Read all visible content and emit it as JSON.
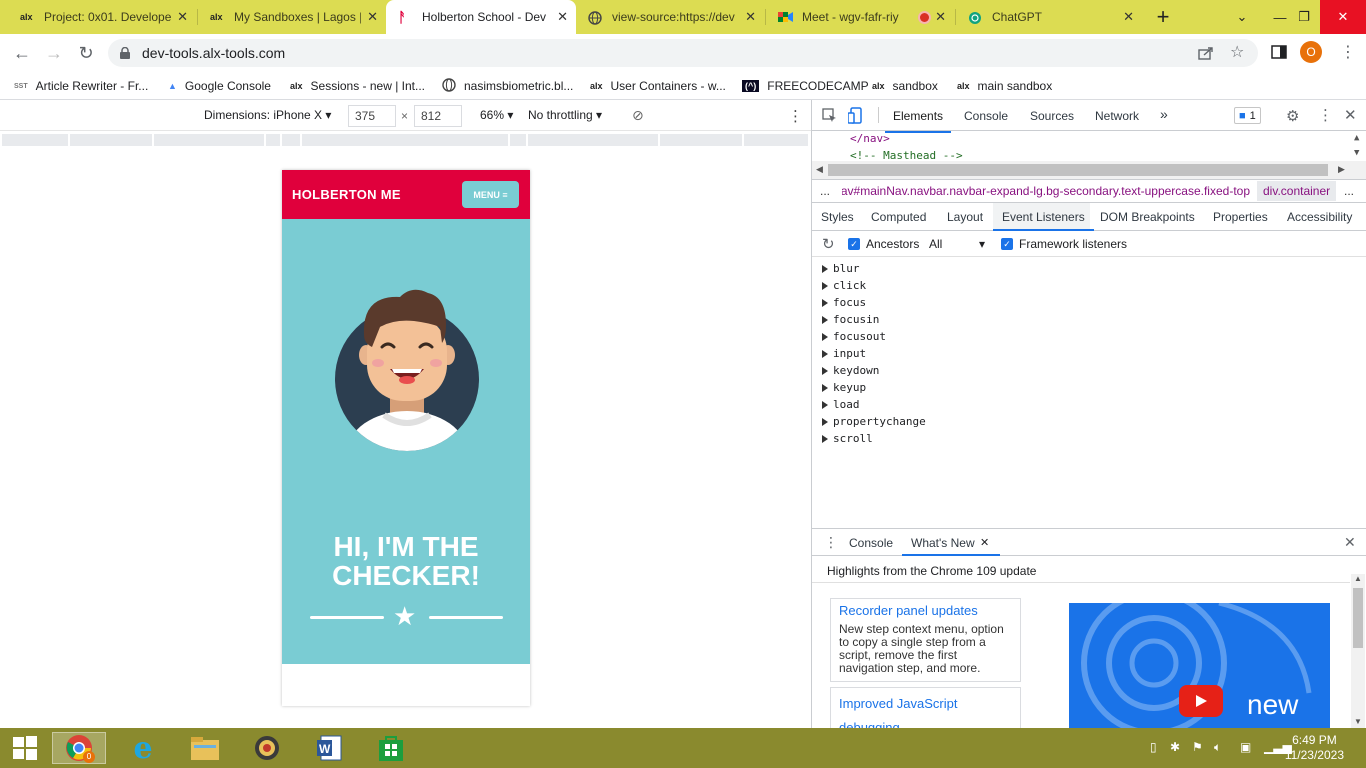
{
  "browser": {
    "tabs": [
      {
        "title": "Project: 0x01. Develope",
        "icon": "alx-icon",
        "active": false
      },
      {
        "title": "My Sandboxes | Lagos |",
        "icon": "alx-icon",
        "active": false
      },
      {
        "title": "Holberton School - Dev",
        "icon": "holberton-icon",
        "active": true
      },
      {
        "title": "view-source:https://dev",
        "icon": "globe-icon",
        "active": false
      },
      {
        "title": "Meet - wgv-fafr-riy",
        "icon": "meet-icon",
        "active": false
      },
      {
        "title": "ChatGPT",
        "icon": "chatgpt-icon",
        "active": false
      }
    ],
    "new_tab": "+",
    "url": "dev-tools.alx-tools.com",
    "profile_initial": "O",
    "bookmarks": [
      {
        "label": "Article Rewriter - Fr...",
        "icon": "SST"
      },
      {
        "label": "Google Console",
        "icon": "gc"
      },
      {
        "label": "Sessions - new | Int...",
        "icon": "alx"
      },
      {
        "label": "nasimsbiometric.bl...",
        "icon": "globe"
      },
      {
        "label": "User Containers - w...",
        "icon": "alx"
      },
      {
        "label": "FREECODECAMP",
        "icon": "fcc"
      },
      {
        "label": "sandbox",
        "icon": "alx"
      },
      {
        "label": "main sandbox",
        "icon": "alx"
      }
    ]
  },
  "device_toolbar": {
    "dimensions_label": "Dimensions: iPhone X",
    "width": "375",
    "times": "×",
    "height": "812",
    "zoom": "66%",
    "throttling": "No throttling"
  },
  "page": {
    "brand": "HOLBERTON ME",
    "menu_label": "MENU ≡",
    "heading_line1": "HI, I'M THE",
    "heading_line2": "CHECKER!"
  },
  "devtools": {
    "tabs": [
      "Elements",
      "Console",
      "Sources",
      "Network"
    ],
    "more": "»",
    "issues_count": "1",
    "code_lines": [
      "</nav>",
      "<!-- Masthead -->"
    ],
    "breadcrumb_ellipsis": "...",
    "breadcrumb_nav": "nav#mainNav.navbar.navbar-expand-lg.bg-secondary.text-uppercase.fixed-top",
    "breadcrumb_div": "div.container",
    "subtabs": [
      "Styles",
      "Computed",
      "Layout",
      "Event Listeners",
      "DOM Breakpoints",
      "Properties",
      "Accessibility"
    ],
    "ancestors_label": "Ancestors",
    "filter_value": "All",
    "framework_label": "Framework listeners",
    "events": [
      "blur",
      "click",
      "focus",
      "focusin",
      "focusout",
      "input",
      "keydown",
      "keyup",
      "load",
      "propertychange",
      "scroll"
    ],
    "drawer_tabs": [
      "Console",
      "What's New"
    ],
    "drawer_heading": "Highlights from the Chrome 109 update",
    "cards": [
      {
        "title": "Recorder panel updates",
        "desc": "New step context menu, option to copy a single step from a script, remove the first navigation step, and more."
      },
      {
        "title": "Improved JavaScript debugging",
        "desc": ""
      }
    ],
    "promo_text": "new"
  },
  "taskbar": {
    "time": "6:49 PM",
    "date": "11/23/2023",
    "chrome_badge": "0"
  }
}
